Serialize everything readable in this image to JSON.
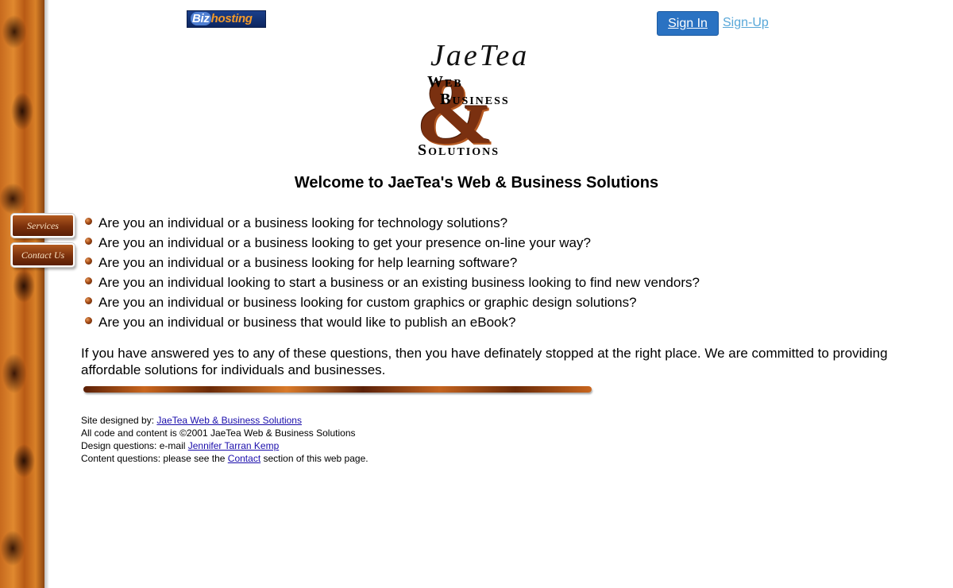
{
  "header": {
    "hosting_logo_prefix": "Biz",
    "hosting_logo_suffix": "hosting",
    "signin_label": "Sign In",
    "signup_label": "Sign-Up"
  },
  "logo": {
    "brand": "JaeTea",
    "line1": "Web",
    "line2": "Business",
    "ampersand": "&",
    "line3": "Solutions"
  },
  "welcome_title": "Welcome to JaeTea's Web & Business Solutions",
  "nav": {
    "services": "Services",
    "contact": "Contact Us"
  },
  "questions": [
    "Are you an individual or a business looking for technology solutions?",
    "Are you an individual or a business looking to get your presence on-line your way?",
    "Are you an individual or a business looking for help learning software?",
    "Are you an individual looking to start a business or an existing business looking to find new vendors?",
    "Are you an individual or business looking for custom graphics or graphic design solutions?",
    "Are you an individual or business that would like to publish an eBook?"
  ],
  "answer_text": "If you have answered yes to any of these questions, then you have definately stopped at the right place. We are committed to providing affordable solutions for individuals and businesses.",
  "footer": {
    "designed_prefix": "Site designed by: ",
    "designed_link": "JaeTea Web & Business Solutions",
    "copyright": "All code and content is ©2001 JaeTea Web & Business Solutions",
    "design_q_prefix": "Design questions: e-mail ",
    "design_q_link": "Jennifer Tarran Kemp",
    "content_q_prefix": "Content questions: please see the ",
    "content_q_link": "Contact",
    "content_q_suffix": " section of this web page."
  },
  "colors": {
    "accent_brown": "#7a300c",
    "signin_blue": "#2a72c2",
    "signup_link": "#58a7d8",
    "link": "#1a0dab"
  }
}
